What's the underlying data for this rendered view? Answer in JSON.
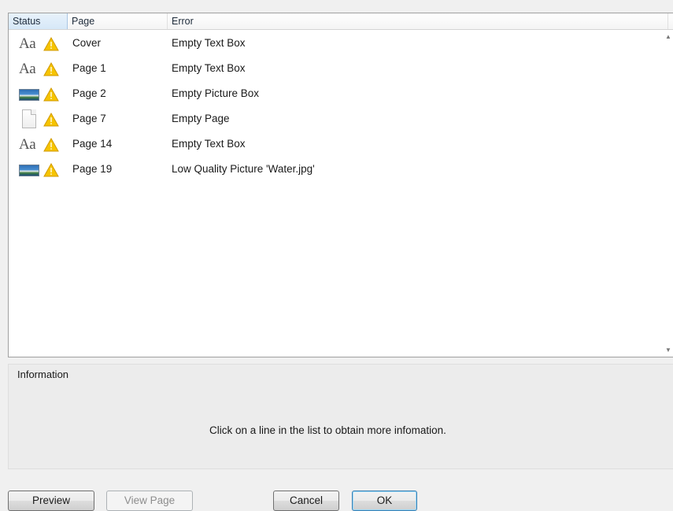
{
  "columns": {
    "status": "Status",
    "page": "Page",
    "error": "Error"
  },
  "rows": [
    {
      "type_icon": "text-type-icon",
      "status_icon": "warning-icon",
      "type_text": "Aa",
      "page": "Cover",
      "error": "Empty Text Box"
    },
    {
      "type_icon": "text-type-icon",
      "status_icon": "warning-icon",
      "type_text": "Aa",
      "page": "Page 1",
      "error": "Empty Text Box"
    },
    {
      "type_icon": "picture-type-icon",
      "status_icon": "warning-icon",
      "page": "Page 2",
      "error": "Empty Picture Box"
    },
    {
      "type_icon": "page-type-icon",
      "status_icon": "warning-icon",
      "page": "Page 7",
      "error": "Empty Page"
    },
    {
      "type_icon": "text-type-icon",
      "status_icon": "warning-icon",
      "type_text": "Aa",
      "page": "Page 14",
      "error": "Empty Text Box"
    },
    {
      "type_icon": "picture-type-icon",
      "status_icon": "warning-icon",
      "page": "Page 19",
      "error": "Low Quality Picture 'Water.jpg'"
    }
  ],
  "information": {
    "legend": "Information",
    "message": "Click on a line in the list to obtain more infomation."
  },
  "buttons": {
    "preview": "Preview",
    "view_page": "View Page",
    "cancel": "Cancel",
    "ok": "OK"
  },
  "colors": {
    "warning": "#f6c400",
    "selected_header": "#d6e8f8",
    "background": "#f0f0f0"
  }
}
